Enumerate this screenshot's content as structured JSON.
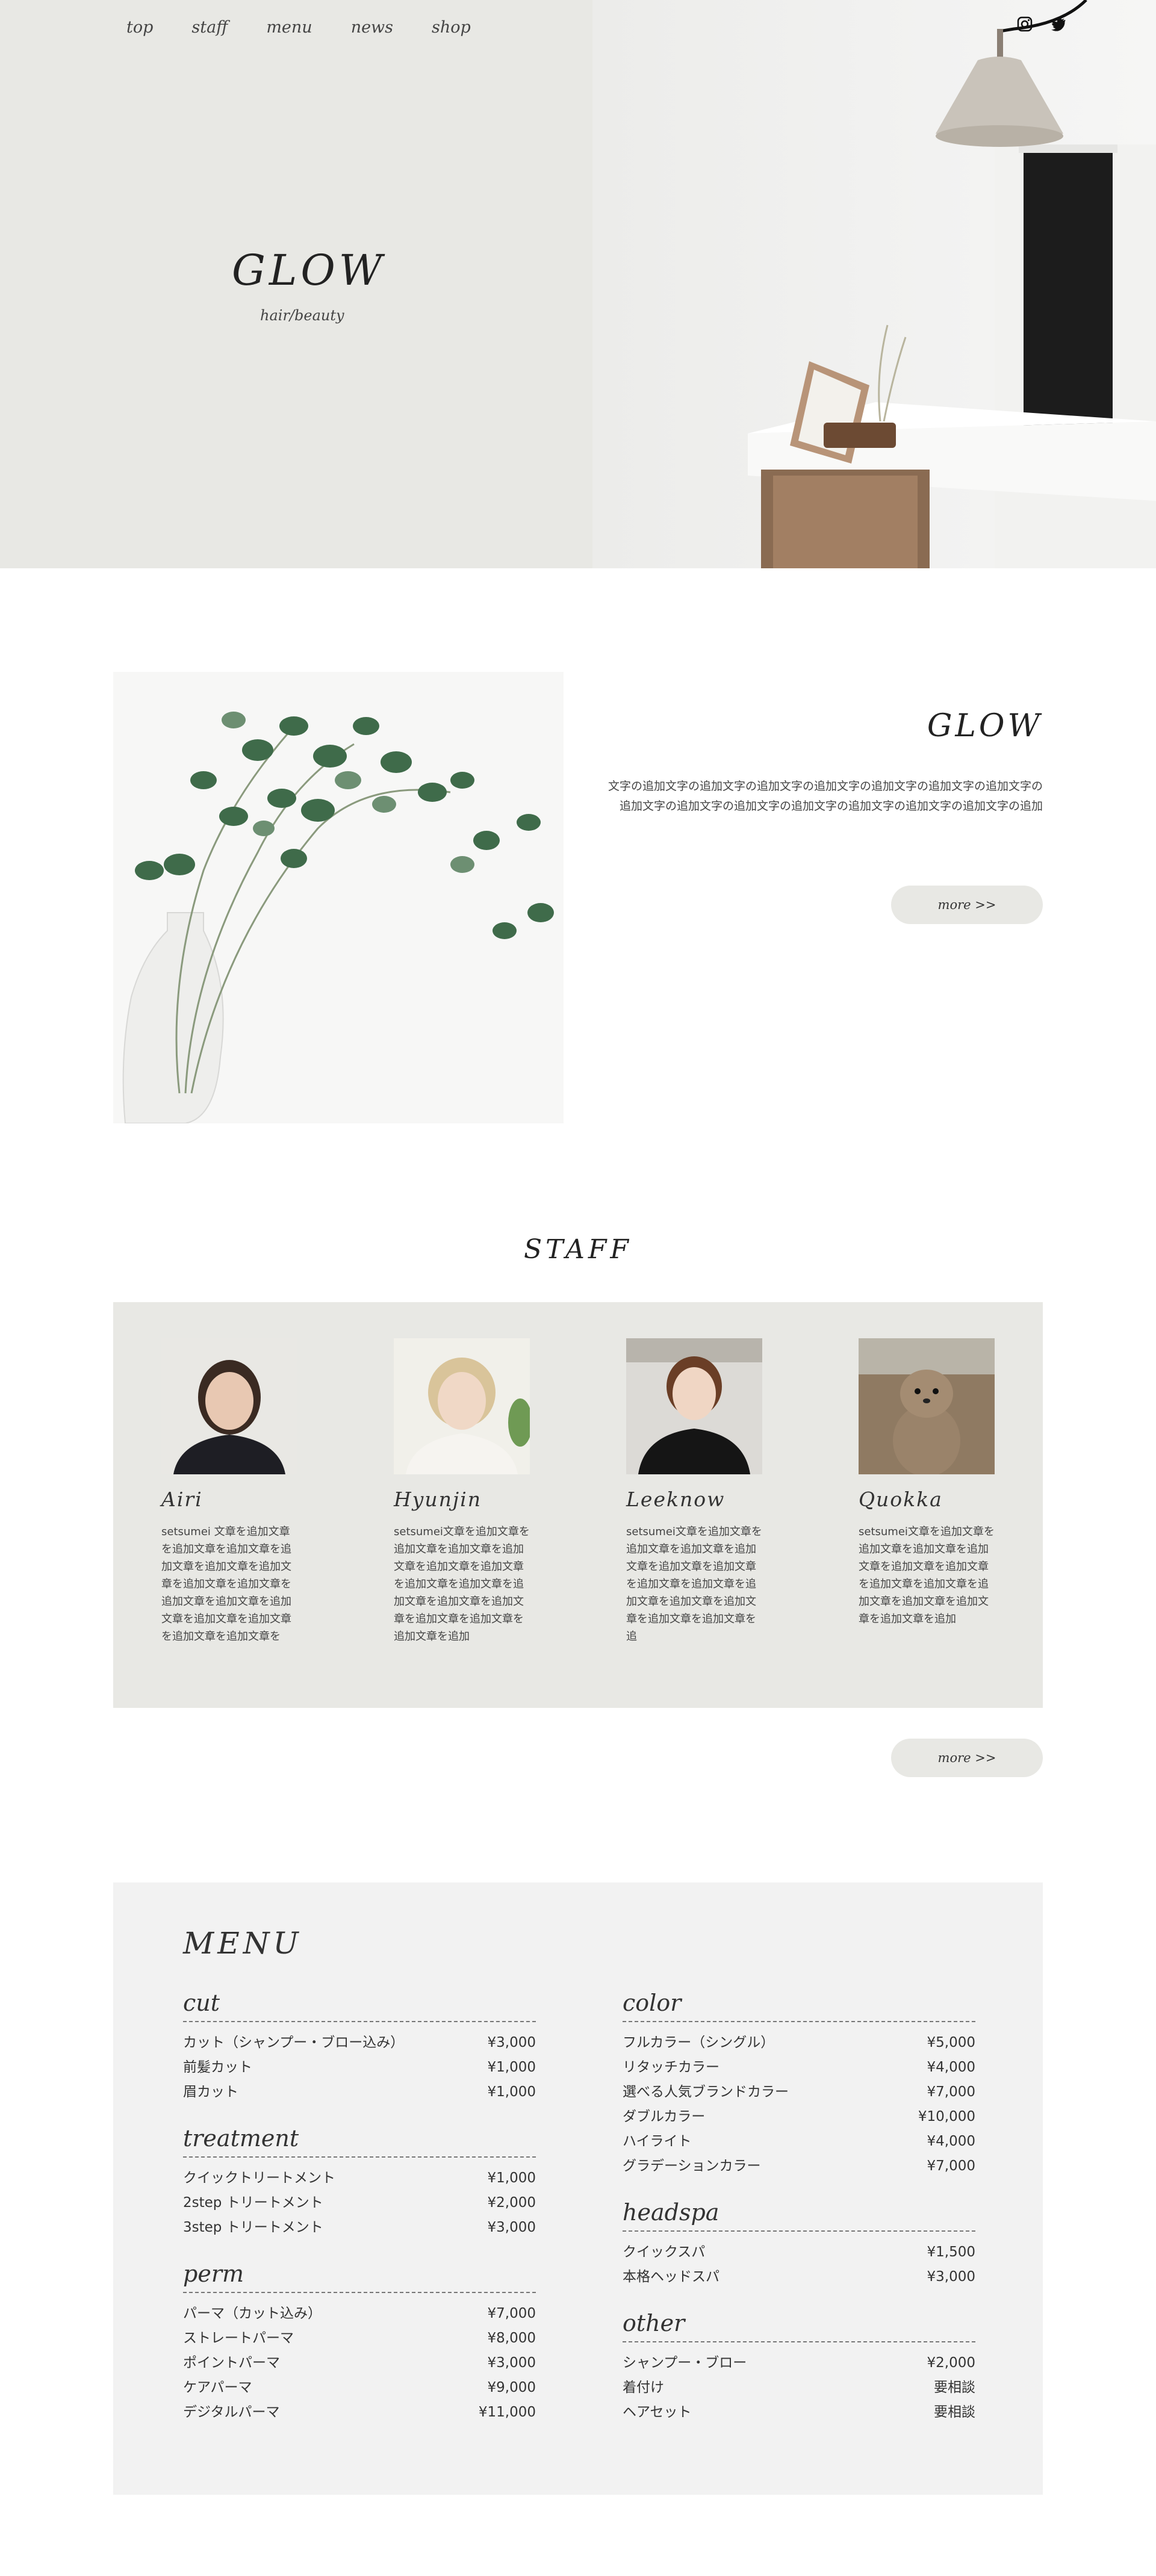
{
  "nav": [
    "top",
    "staff",
    "menu",
    "news",
    "shop"
  ],
  "social": [
    "instagram-icon",
    "twitter-icon"
  ],
  "hero": {
    "brand": "GLOW",
    "sub": "hair/beauty"
  },
  "about": {
    "title": "GLOW",
    "text": "文字の追加文字の追加文字の追加文字の追加文字の追加文字の追加文字の追加文字の追加文字の追加文字の追加文字の追加文字の追加文字の追加文字の追加文字の追加",
    "more": "more >>"
  },
  "staff": {
    "title": "STAFF",
    "more": "more >>",
    "members": [
      {
        "name": "Airi",
        "desc": "setsumei 文章を追加文章を追加文章を追加文章を追加文章を追加文章を追加文章を追加文章を追加文章を追加文章を追加文章を追加文章を追加文章を追加文章を追加文章を追加文章を"
      },
      {
        "name": "Hyunjin",
        "desc": "setsumei文章を追加文章を追加文章を追加文章を追加文章を追加文章を追加文章を追加文章を追加文章を追加文章を追加文章を追加文章を追加文章を追加文章を追加文章を追加"
      },
      {
        "name": "Leeknow",
        "desc": "setsumei文章を追加文章を追加文章を追加文章を追加文章を追加文章を追加文章を追加文章を追加文章を追加文章を追加文章を追加文章を追加文章を追加文章を追"
      },
      {
        "name": "Quokka",
        "desc": "setsumei文章を追加文章を追加文章を追加文章を追加文章を追加文章を追加文章を追加文章を追加文章を追加文章を追加文章を追加文章を追加文章を追加"
      }
    ]
  },
  "menu": {
    "title": "MENU",
    "left": [
      {
        "name": "cut",
        "items": [
          {
            "label": "カット（シャンプー・ブロー込み）",
            "price": "¥3,000"
          },
          {
            "label": "前髪カット",
            "price": "¥1,000"
          },
          {
            "label": "眉カット",
            "price": "¥1,000"
          }
        ]
      },
      {
        "name": "treatment",
        "items": [
          {
            "label": "クイックトリートメント",
            "price": "¥1,000"
          },
          {
            "label": "2step トリートメント",
            "price": "¥2,000"
          },
          {
            "label": "3step トリートメント",
            "price": "¥3,000"
          }
        ]
      },
      {
        "name": "perm",
        "items": [
          {
            "label": "パーマ（カット込み）",
            "price": "¥7,000"
          },
          {
            "label": "ストレートパーマ",
            "price": "¥8,000"
          },
          {
            "label": "ポイントパーマ",
            "price": "¥3,000"
          },
          {
            "label": "ケアパーマ",
            "price": "¥9,000"
          },
          {
            "label": "デジタルパーマ",
            "price": "¥11,000"
          }
        ]
      }
    ],
    "right": [
      {
        "name": "color",
        "items": [
          {
            "label": "フルカラー（シングル）",
            "price": "¥5,000"
          },
          {
            "label": "リタッチカラー",
            "price": "¥4,000"
          },
          {
            "label": "選べる人気ブランドカラー",
            "price": "¥7,000"
          },
          {
            "label": "ダブルカラー",
            "price": "¥10,000"
          },
          {
            "label": "ハイライト",
            "price": "¥4,000"
          },
          {
            "label": "グラデーションカラー",
            "price": "¥7,000"
          }
        ]
      },
      {
        "name": "headspa",
        "items": [
          {
            "label": "クイックスパ",
            "price": "¥1,500"
          },
          {
            "label": "本格ヘッドスパ",
            "price": "¥3,000"
          }
        ]
      },
      {
        "name": "other",
        "items": [
          {
            "label": "シャンプー・ブロー",
            "price": "¥2,000"
          },
          {
            "label": "着付け",
            "price": "要相談"
          },
          {
            "label": "ヘアセット",
            "price": "要相談"
          }
        ]
      }
    ]
  }
}
